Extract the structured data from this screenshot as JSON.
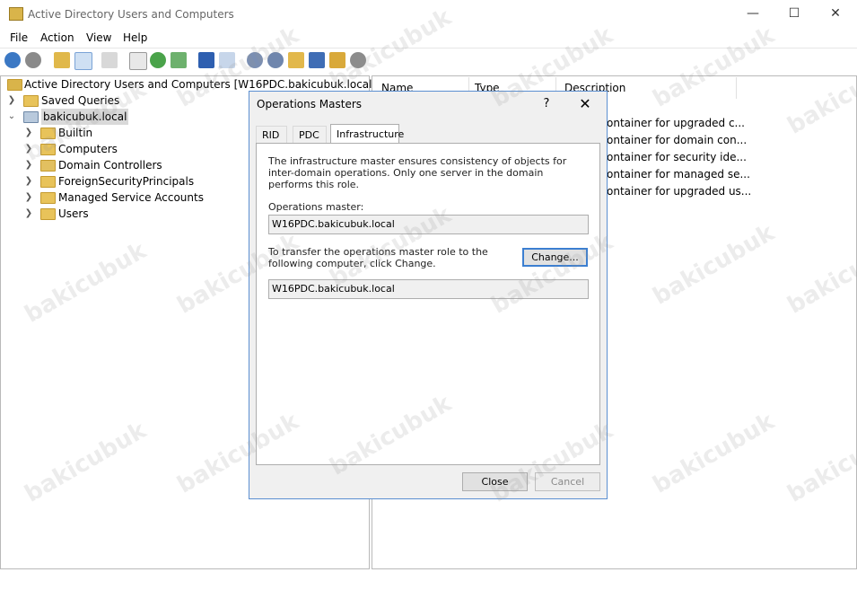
{
  "window": {
    "title": "Active Directory Users and Computers"
  },
  "menu": [
    "File",
    "Action",
    "View",
    "Help"
  ],
  "tree": {
    "root": "Active Directory Users and Computers [W16PDC.bakicubuk.local]",
    "saved_queries": "Saved Queries",
    "domain": "bakicubuk.local",
    "children": [
      "Builtin",
      "Computers",
      "Domain Controllers",
      "ForeignSecurityPrincipals",
      "Managed Service Accounts",
      "Users"
    ]
  },
  "list": {
    "columns": [
      "Name",
      "Type",
      "Description"
    ],
    "descriptions": [
      "ontainer for upgraded c...",
      "ontainer for domain con...",
      "ontainer for security ide...",
      "ontainer for managed se...",
      "ontainer for upgraded us..."
    ]
  },
  "dialog": {
    "title": "Operations Masters",
    "help": "?",
    "close_glyph": "✕",
    "tabs": [
      "RID",
      "PDC",
      "Infrastructure"
    ],
    "active_tab": "Infrastructure",
    "intro": "The infrastructure master ensures consistency of objects for inter-domain operations. Only one server in the domain performs this role.",
    "ops_master_label": "Operations master:",
    "ops_master_value": "W16PDC.bakicubuk.local",
    "transfer_text": "To transfer the operations master role to the following computer, click Change.",
    "transfer_value": "W16PDC.bakicubuk.local",
    "change_label": "Change...",
    "close_label": "Close",
    "cancel_label": "Cancel"
  },
  "watermark": "bakicubuk"
}
